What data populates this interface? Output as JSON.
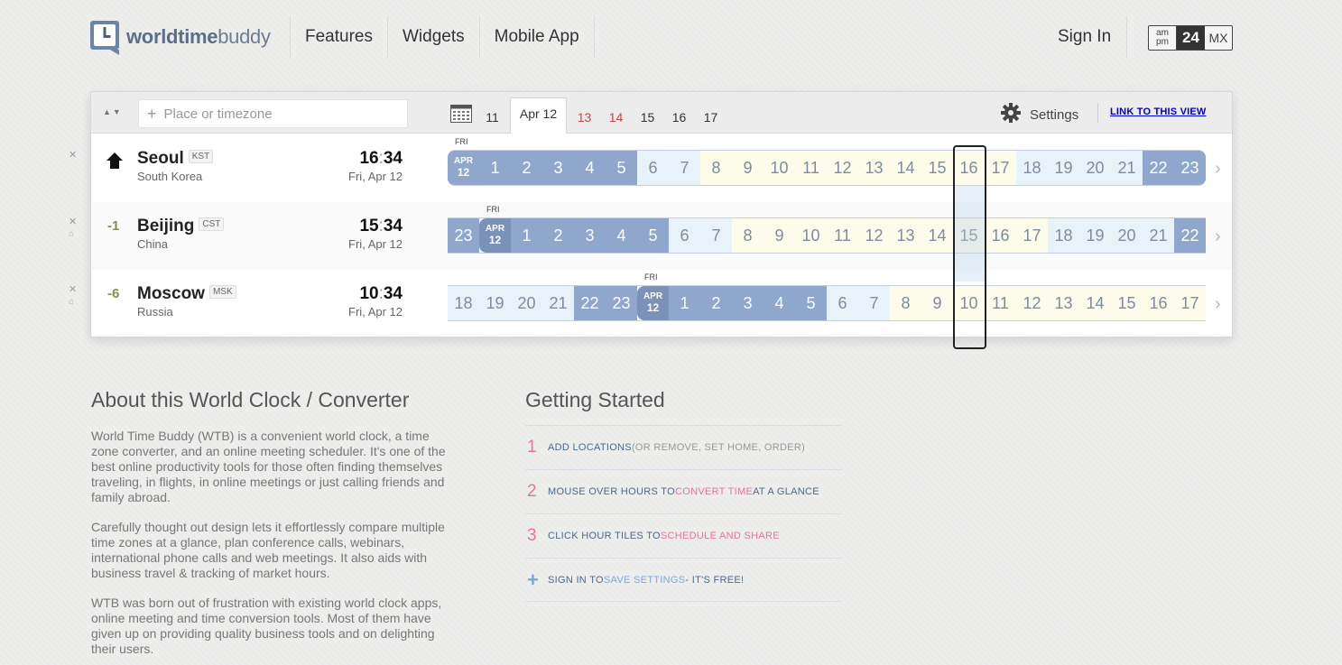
{
  "nav": {
    "logo_bold": "worldtime",
    "logo_light": "buddy",
    "items": [
      "Features",
      "Widgets",
      "Mobile App"
    ],
    "sign_in": "Sign In",
    "format": {
      "ampm_top": "am",
      "ampm_bottom": "pm",
      "h24": "24",
      "mx": "MX"
    }
  },
  "toolbar": {
    "search_placeholder": "Place or timezone",
    "dates": [
      "11",
      "Apr 12",
      "13",
      "14",
      "15",
      "16",
      "17"
    ],
    "active_date": "Apr 12",
    "weekend_dates": [
      "13",
      "14"
    ],
    "settings_label": "Settings",
    "link_label": "LINK TO THIS VIEW"
  },
  "rows": [
    {
      "offset": "",
      "city": "Seoul",
      "tz": "KST",
      "country": "South Korea",
      "hour": "16",
      "minute": "34",
      "date": "Fri, Apr 12",
      "day_label": "FRI",
      "mid_month": "APR",
      "mid_day": "12",
      "hours": [
        "APR12",
        "1",
        "2",
        "3",
        "4",
        "5",
        "6",
        "7",
        "8",
        "9",
        "10",
        "11",
        "12",
        "13",
        "14",
        "15",
        "16",
        "17",
        "18",
        "19",
        "20",
        "21",
        "22",
        "23"
      ]
    },
    {
      "offset": "-1",
      "city": "Beijing",
      "tz": "CST",
      "country": "China",
      "hour": "15",
      "minute": "34",
      "date": "Fri, Apr 12",
      "day_label": "FRI",
      "mid_month": "APR",
      "mid_day": "12",
      "hours": [
        "23",
        "APR12",
        "1",
        "2",
        "3",
        "4",
        "5",
        "6",
        "7",
        "8",
        "9",
        "10",
        "11",
        "12",
        "13",
        "14",
        "15",
        "16",
        "17",
        "18",
        "19",
        "20",
        "21",
        "22"
      ]
    },
    {
      "offset": "-6",
      "city": "Moscow",
      "tz": "MSK",
      "country": "Russia",
      "hour": "10",
      "minute": "34",
      "date": "Fri, Apr 12",
      "day_label": "FRI",
      "mid_month": "APR",
      "mid_day": "12",
      "hours": [
        "18",
        "19",
        "20",
        "21",
        "22",
        "23",
        "APR12",
        "1",
        "2",
        "3",
        "4",
        "5",
        "6",
        "7",
        "8",
        "9",
        "10",
        "11",
        "12",
        "13",
        "14",
        "15",
        "16",
        "17"
      ]
    }
  ],
  "about": {
    "title": "About this World Clock / Converter",
    "p1": "World Time Buddy (WTB) is a convenient world clock, a time zone converter, and an online meeting scheduler. It's one of the best online productivity tools for those often finding themselves traveling, in flights, in online meetings or just calling friends and family abroad.",
    "p2": "Carefully thought out design lets it effortlessly compare multiple time zones at a glance, plan conference calls, webinars, international phone calls and web meetings. It also aids with business travel & tracking of market hours.",
    "p3": "WTB was born out of frustration with existing world clock apps, online meeting and time conversion tools. Most of them have given up on providing quality business tools and on delighting their users."
  },
  "getting_started": {
    "title": "Getting Started",
    "s1_num": "1",
    "s1_a": "ADD LOCATIONS",
    "s1_b": " (OR REMOVE, SET HOME, ORDER)",
    "s2_num": "2",
    "s2_a": "MOUSE OVER HOURS TO ",
    "s2_b": "CONVERT TIME",
    "s2_c": " AT A GLANCE",
    "s3_num": "3",
    "s3_a": "CLICK HOUR TILES TO ",
    "s3_b": "SCHEDULE AND SHARE",
    "s4_plus": "+",
    "s4_a": "SIGN IN TO ",
    "s4_b": "SAVE SETTINGS",
    "s4_c": " - IT'S FREE!"
  },
  "colors": {
    "night": "#8fa7cd",
    "dawn": "#e7f2fb",
    "day": "#fdfbe9",
    "accent_pink": "#e8729c",
    "accent_blue": "#7aa6e6"
  }
}
